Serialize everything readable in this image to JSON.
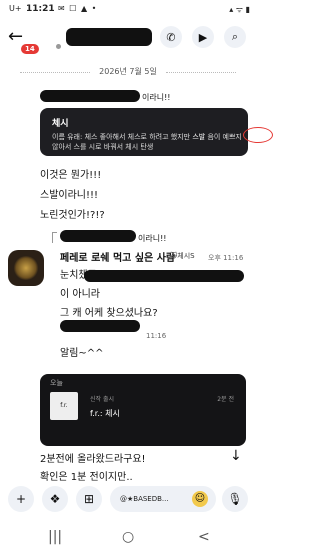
{
  "status": {
    "carrier": "U+",
    "time": "11:21",
    "icons": "✉ ☐ ▲ •",
    "right": "▴ ᯤ ▮"
  },
  "header": {
    "unread_badge": "14",
    "call_icon": "phone-icon",
    "video_icon": "video-icon",
    "search_icon": "search-icon"
  },
  "date_divider": "2026년 7월 5일",
  "reply_to": {
    "preview_name": "이라니!!",
    "title": "체시",
    "text_before": "이름 유래: 체스 좋아해서 체스로 하려고 했지만",
    "text_circled": "스발",
    "text_after": "음이 예쁘지 않아서 스를 시로 바꿔서 체시 탄생"
  },
  "messages": [
    {
      "text": "이것은 뭔가!!!"
    },
    {
      "text": "스발이라니!!!"
    },
    {
      "text": "노린것인가!?!?"
    }
  ],
  "other": {
    "reply_quote": "이라니!!",
    "name": "페레로 로쉐 먹고 싶은 사람",
    "tag": "😺체시S",
    "time": "오후 11:16",
    "lines": [
      "눈치챘군",
      "이 아니라",
      "그 캐 어케 찾으셨나요?"
    ],
    "time2": "11:16",
    "notify": "알림~^^"
  },
  "share": {
    "header": "오늘",
    "badge": "신작 출시",
    "title": "f.r.: 체시",
    "ago": "2분 전",
    "thumb_caption": "f.r."
  },
  "after_share": [
    "2분전에 올라왔드라구요!",
    "확인은 1분 전이지만.."
  ],
  "composer": {
    "input_text": "@★BASEDB..."
  },
  "nav": {
    "recents": "|||",
    "home": "○",
    "back": "<"
  }
}
